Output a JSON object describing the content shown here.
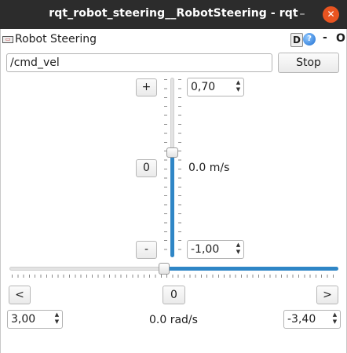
{
  "window": {
    "title": "rqt_robot_steering__RobotSteering - rqt",
    "minimize": "–",
    "close": "✕"
  },
  "plugin": {
    "title": "Robot Steering",
    "icon": "steering-plugin-icon",
    "d_label": "D",
    "help_label": "?",
    "dash_label": "-",
    "float_label": "O"
  },
  "topic": {
    "value": "/cmd_vel"
  },
  "stop_button": "Stop",
  "linear": {
    "increase_label": "+",
    "reset_label": "0",
    "decrease_label": "-",
    "max_value": "0,70",
    "min_value": "-1,00",
    "current_label": "0.0 m/s",
    "slider_level": 0.59
  },
  "angular": {
    "left_label": "<",
    "reset_label": "0",
    "right_label": ">",
    "max_value": "3,00",
    "min_value": "-3,40",
    "current_label": "0.0 rad/s",
    "slider_level": 0.47
  },
  "colors": {
    "titlebar": "#2c2c2c",
    "close": "#e95420",
    "slider_fill": "#2f86c6"
  }
}
